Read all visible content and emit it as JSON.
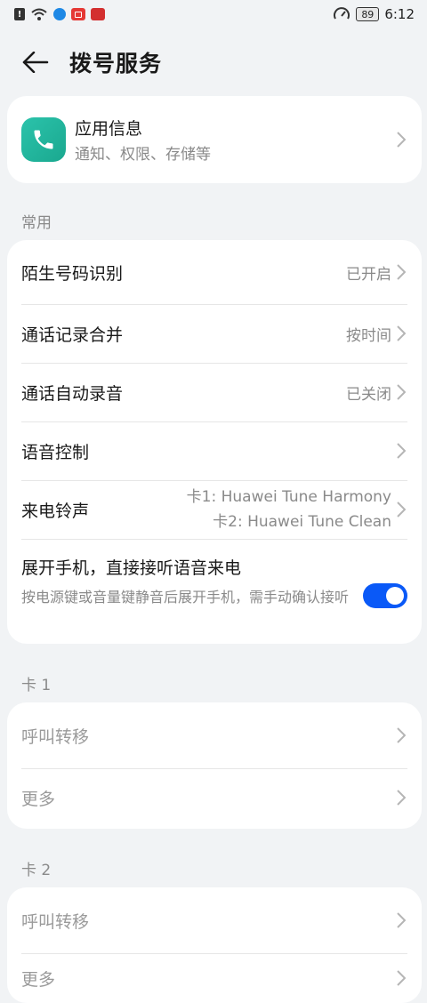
{
  "status_bar": {
    "time": "6:12",
    "battery": "89"
  },
  "header": {
    "title": "拨号服务"
  },
  "app_info": {
    "title": "应用信息",
    "subtitle": "通知、权限、存储等"
  },
  "sections": {
    "common": "常用",
    "card1": "卡 1",
    "card2": "卡 2"
  },
  "common_items": [
    {
      "title": "陌生号码识别",
      "value": "已开启"
    },
    {
      "title": "通话记录合并",
      "value": "按时间"
    },
    {
      "title": "通话自动录音",
      "value": "已关闭"
    },
    {
      "title": "语音控制",
      "value": ""
    }
  ],
  "ringtone": {
    "title": "来电铃声",
    "card1": "卡1: Huawei Tune Harmony",
    "card2": "卡2: Huawei Tune Clean"
  },
  "unfold_answer": {
    "title": "展开手机，直接接听语音来电",
    "desc": "按电源键或音量键静音后展开手机，需手动确认接听",
    "enabled": true
  },
  "card1_items": [
    {
      "title": "呼叫转移"
    },
    {
      "title": "更多"
    }
  ],
  "card2_items": [
    {
      "title": "呼叫转移"
    },
    {
      "title": "更多"
    }
  ],
  "colors": {
    "accent": "#0a59f7",
    "app_icon": "#22b8a0",
    "background": "#f1f3f5"
  }
}
